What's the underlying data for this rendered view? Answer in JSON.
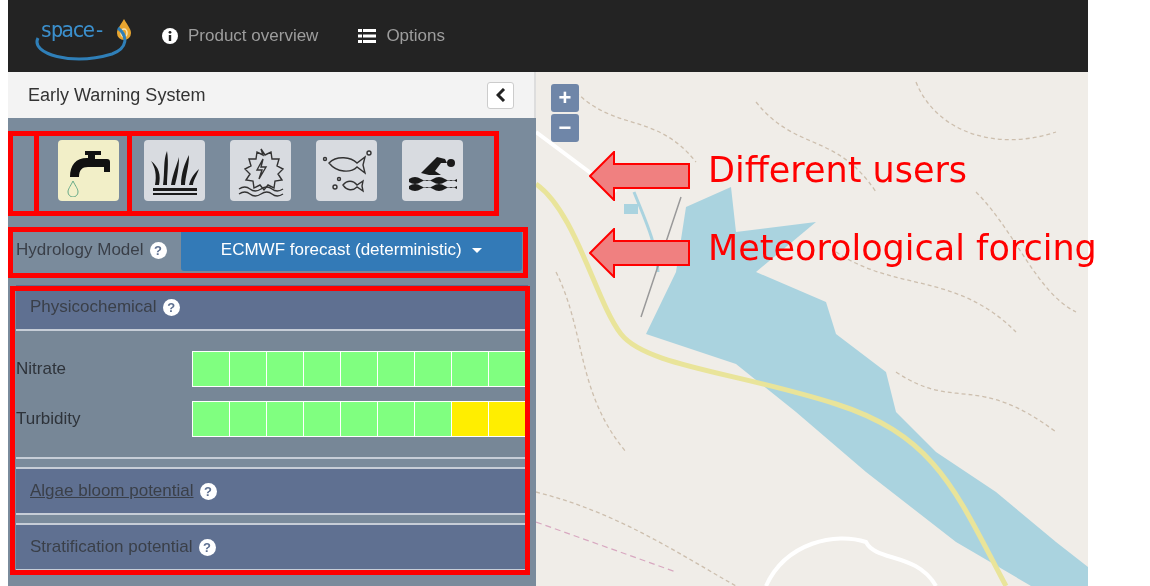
{
  "header": {
    "logo": "space-",
    "nav": [
      {
        "kind": "info",
        "label": "Product overview"
      },
      {
        "kind": "list",
        "label": "Options"
      }
    ]
  },
  "sidebar": {
    "title": "Early Warning System",
    "users": [
      {
        "kind": "tap",
        "selected": true
      },
      {
        "kind": "reeds",
        "selected": false
      },
      {
        "kind": "hydropower",
        "selected": false
      },
      {
        "kind": "fish",
        "selected": false
      },
      {
        "kind": "swimming",
        "selected": false
      }
    ],
    "hydrology": {
      "label": "Hydrology Model",
      "help": "?",
      "value": "ECMWF forecast (deterministic)"
    },
    "sections": [
      {
        "title": "Physicochemical",
        "help": "?",
        "link": false,
        "rows": [
          {
            "label": "Nitrate",
            "cells": [
              {
                "color": "#80ff80"
              },
              {
                "color": "#80ff80"
              },
              {
                "color": "#80ff80"
              },
              {
                "color": "#80ff80"
              },
              {
                "color": "#80ff80"
              },
              {
                "color": "#80ff80"
              },
              {
                "color": "#80ff80"
              },
              {
                "color": "#80ff80"
              },
              {
                "color": "#80ff80"
              }
            ]
          },
          {
            "label": "Turbidity",
            "cells": [
              {
                "color": "#80ff80"
              },
              {
                "color": "#80ff80"
              },
              {
                "color": "#80ff80"
              },
              {
                "color": "#80ff80"
              },
              {
                "color": "#80ff80"
              },
              {
                "color": "#80ff80"
              },
              {
                "color": "#80ff80"
              },
              {
                "color": "#ffee00"
              },
              {
                "color": "#ffee00"
              }
            ]
          }
        ]
      },
      {
        "title": "Algae bloom potential",
        "help": "?",
        "link": true
      },
      {
        "title": "Stratification potential",
        "help": "?",
        "link": false
      }
    ]
  },
  "map": {
    "zoom_in": "+",
    "zoom_out": "−"
  },
  "annotations": [
    {
      "text": "Different users"
    },
    {
      "text": "Meteorological forcing"
    }
  ]
}
